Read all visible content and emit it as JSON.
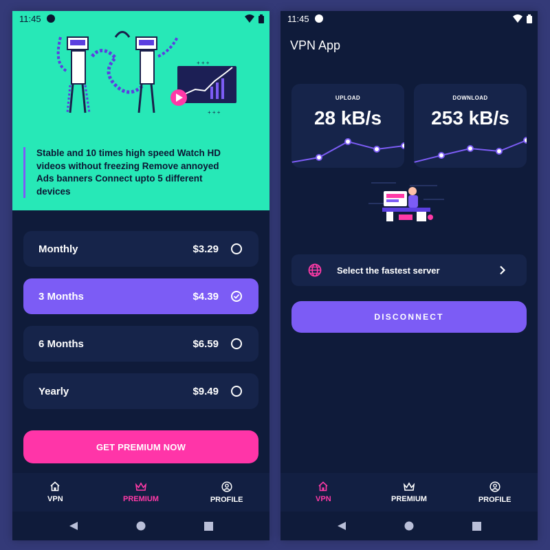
{
  "status_bar": {
    "time": "11:45"
  },
  "premium_screen": {
    "hero_text": "Stable and 10 times high speed Watch HD videos without freezing Remove annoyed Ads banners Connect upto 5 different devices",
    "plans": [
      {
        "name": "Monthly",
        "price": "$3.29",
        "selected": false
      },
      {
        "name": "3 Months",
        "price": "$4.39",
        "selected": true
      },
      {
        "name": "6 Months",
        "price": "$6.59",
        "selected": false
      },
      {
        "name": "Yearly",
        "price": "$9.49",
        "selected": false
      }
    ],
    "cta_label": "GET PREMIUM NOW"
  },
  "vpn_screen": {
    "title": "VPN App",
    "upload": {
      "label": "UPLOAD",
      "value": "28 kB/s"
    },
    "download": {
      "label": "DOWNLOAD",
      "value": "253 kB/s"
    },
    "server_label": "Select the fastest server",
    "disconnect_label": "DISCONNECT"
  },
  "bottom_nav": {
    "vpn": "VPN",
    "premium": "PREMIUM",
    "profile": "PROFILE"
  },
  "icons": {
    "home": "home-icon",
    "crown": "crown-icon",
    "profile": "profile-icon",
    "globe": "globe-icon",
    "chevron": "chevron-right-icon",
    "check": "check-icon"
  },
  "colors": {
    "background": "#343a78",
    "screen": "#0f1b3a",
    "card": "#16244a",
    "mint": "#27e8b7",
    "purple": "#7c5cf5",
    "pink": "#ff35a8"
  }
}
